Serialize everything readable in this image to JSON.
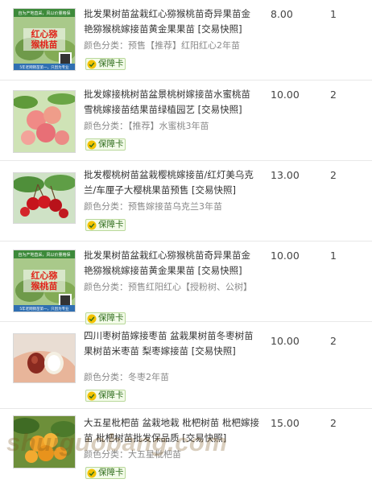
{
  "items": [
    {
      "title": "批发果树苗盆栽红心猕猴桃苗奇异果苗金艳猕猴桃嫁接苗黄金果果苗 [交易快照]",
      "variant": "颜色分类：预售【推荐】红阳红心2年苗",
      "badge": "保障卡",
      "price": "8.00",
      "qty": "1",
      "thumb_icon": "kiwi-seedling-photo-icon"
    },
    {
      "title": "批发嫁接桃树苗盆景桃树嫁接苗水蜜桃苗雪桃嫁接苗结果苗绿植园艺 [交易快照]",
      "variant": "颜色分类：【推荐】水蜜桃3年苗",
      "badge": "保障卡",
      "price": "10.00",
      "qty": "2",
      "thumb_icon": "peach-fruit-photo-icon"
    },
    {
      "title": "批发樱桃树苗盆栽樱桃嫁接苗/红灯美乌克兰/车厘子大樱桃果苗预售 [交易快照]",
      "variant": "颜色分类：预售嫁接苗乌克兰3年苗",
      "badge": "保障卡",
      "price": "13.00",
      "qty": "2",
      "thumb_icon": "cherry-fruit-photo-icon"
    },
    {
      "title": "批发果树苗盆栽红心猕猴桃苗奇异果苗金艳猕猴桃嫁接苗黄金果果苗 [交易快照]",
      "variant": "颜色分类：预售红阳红心【授粉树、公树】",
      "badge": "保障卡",
      "price": "10.00",
      "qty": "1",
      "thumb_icon": "kiwi-seedling-photo-icon"
    },
    {
      "title": "四川枣树苗嫁接枣苗 盆栽果树苗冬枣树苗果树苗米枣苗 梨枣嫁接苗 [交易快照]",
      "variant": "颜色分类：冬枣2年苗",
      "badge": "保障卡",
      "price": "10.00",
      "qty": "2",
      "thumb_icon": "jujube-hand-photo-icon"
    },
    {
      "title": "大五星枇杷苗 盆栽地栽 枇杷树苗 枇杷嫁接苗 枇杷树苗批发保品质 [交易快照]",
      "variant": "颜色分类：大五星枇杷苗",
      "badge": "保障卡",
      "price": "15.00",
      "qty": "2",
      "thumb_icon": "loquat-fruit-photo-icon"
    }
  ],
  "kiwi_thumb_text": {
    "top": "自为产地直采，风以价量格保",
    "title_line1": "红心猕",
    "title_line2": "猴桃苗",
    "bottom": "5年老网销苗第一，只因为专业"
  },
  "watermark": "shuiguobang.com",
  "colors": {
    "badge_border": "#b9d89a",
    "badge_bg": "#f3fbe9",
    "badge_text": "#2f6d1c",
    "badge_icon": "#e8b800",
    "divider": "#e8e8e8",
    "variant_text": "#8a8a8a"
  }
}
